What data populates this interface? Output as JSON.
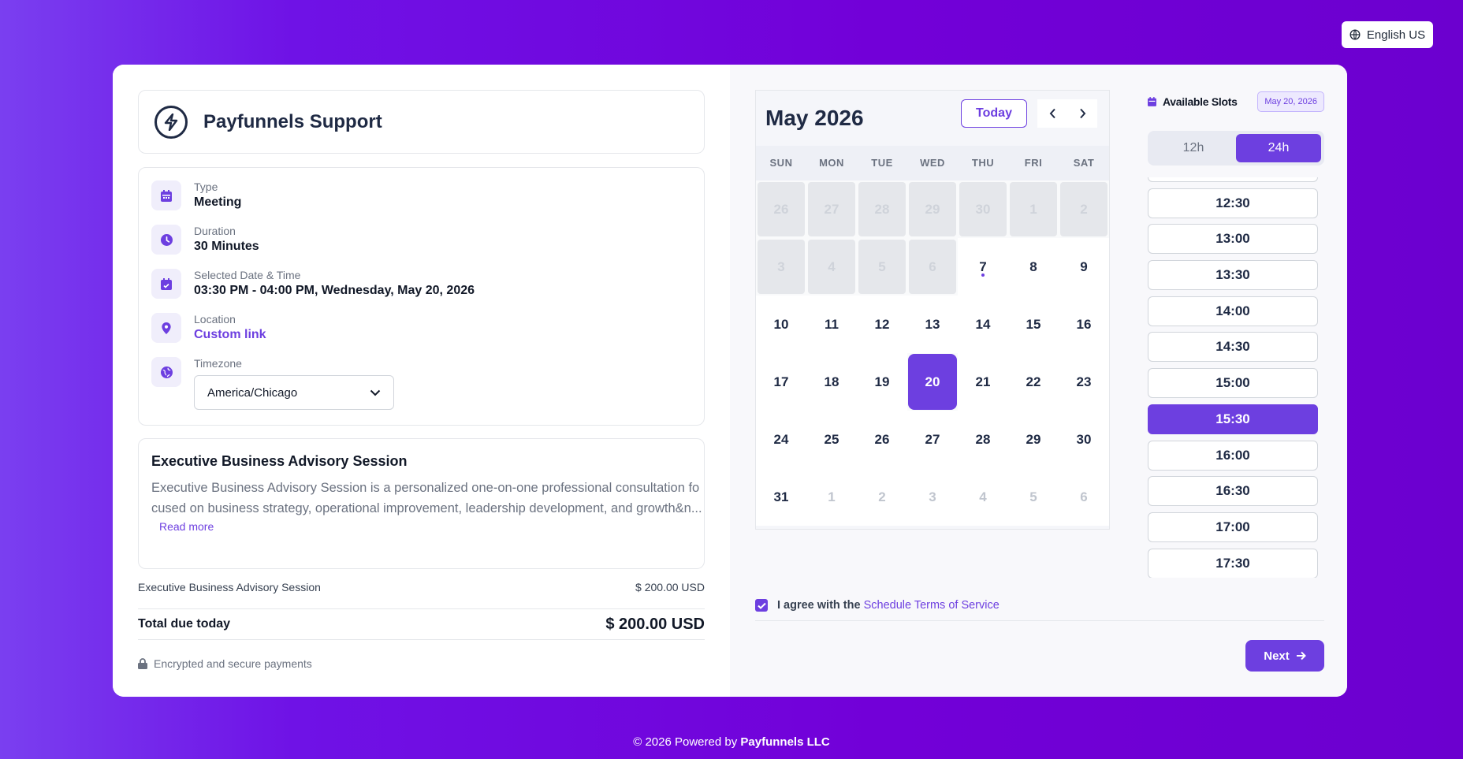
{
  "language": "English US",
  "event": {
    "title": "Payfunnels Support",
    "type_label": "Type",
    "type_value": "Meeting",
    "duration_label": "Duration",
    "duration_value": "30 Minutes",
    "datetime_label": "Selected Date & Time",
    "datetime_value": "03:30 PM - 04:00 PM, Wednesday, May 20, 2026",
    "location_label": "Location",
    "location_value": "Custom link",
    "timezone_label": "Timezone",
    "timezone_value": "America/Chicago"
  },
  "description": {
    "title": "Executive Business Advisory Session",
    "text": "Executive Business Advisory Session is a personalized one-on-one professional consultation focused on business strategy, operational improvement, leadership development, and growth&n...",
    "read_more": "Read more"
  },
  "pricing": {
    "item_label": "Executive Business Advisory Session",
    "item_amount": "$ 200.00 USD",
    "total_label": "Total due today",
    "total_amount": "$ 200.00 USD",
    "secure_text": "Encrypted and secure payments"
  },
  "calendar": {
    "month": "May 2026",
    "today_label": "Today",
    "weekdays": [
      "SUN",
      "MON",
      "TUE",
      "WED",
      "THU",
      "FRI",
      "SAT"
    ],
    "days": [
      {
        "n": "26",
        "s": "disabled"
      },
      {
        "n": "27",
        "s": "disabled"
      },
      {
        "n": "28",
        "s": "disabled"
      },
      {
        "n": "29",
        "s": "disabled"
      },
      {
        "n": "30",
        "s": "disabled"
      },
      {
        "n": "1",
        "s": "disabled"
      },
      {
        "n": "2",
        "s": "disabled"
      },
      {
        "n": "3",
        "s": "disabled"
      },
      {
        "n": "4",
        "s": "disabled"
      },
      {
        "n": "5",
        "s": "disabled"
      },
      {
        "n": "6",
        "s": "disabled"
      },
      {
        "n": "7",
        "s": "today"
      },
      {
        "n": "8",
        "s": ""
      },
      {
        "n": "9",
        "s": ""
      },
      {
        "n": "10",
        "s": ""
      },
      {
        "n": "11",
        "s": ""
      },
      {
        "n": "12",
        "s": ""
      },
      {
        "n": "13",
        "s": ""
      },
      {
        "n": "14",
        "s": ""
      },
      {
        "n": "15",
        "s": ""
      },
      {
        "n": "16",
        "s": ""
      },
      {
        "n": "17",
        "s": ""
      },
      {
        "n": "18",
        "s": ""
      },
      {
        "n": "19",
        "s": ""
      },
      {
        "n": "20",
        "s": "selected"
      },
      {
        "n": "21",
        "s": ""
      },
      {
        "n": "22",
        "s": ""
      },
      {
        "n": "23",
        "s": ""
      },
      {
        "n": "24",
        "s": ""
      },
      {
        "n": "25",
        "s": ""
      },
      {
        "n": "26",
        "s": ""
      },
      {
        "n": "27",
        "s": ""
      },
      {
        "n": "28",
        "s": ""
      },
      {
        "n": "29",
        "s": ""
      },
      {
        "n": "30",
        "s": ""
      },
      {
        "n": "31",
        "s": ""
      },
      {
        "n": "1",
        "s": "other"
      },
      {
        "n": "2",
        "s": "other"
      },
      {
        "n": "3",
        "s": "other"
      },
      {
        "n": "4",
        "s": "other"
      },
      {
        "n": "5",
        "s": "other"
      },
      {
        "n": "6",
        "s": "other"
      }
    ]
  },
  "slots": {
    "title": "Available Slots",
    "date_badge": "May 20, 2026",
    "format_12": "12h",
    "format_24": "24h",
    "times": [
      "12:30",
      "13:00",
      "13:30",
      "14:00",
      "14:30",
      "15:00",
      "15:30",
      "16:00",
      "16:30",
      "17:00",
      "17:30"
    ],
    "selected": "15:30"
  },
  "terms": {
    "prefix": "I agree with the",
    "link": "Schedule Terms of Service"
  },
  "next_label": "Next",
  "footer": {
    "prefix": "© 2026 Powered by",
    "brand": "Payfunnels LLC"
  }
}
